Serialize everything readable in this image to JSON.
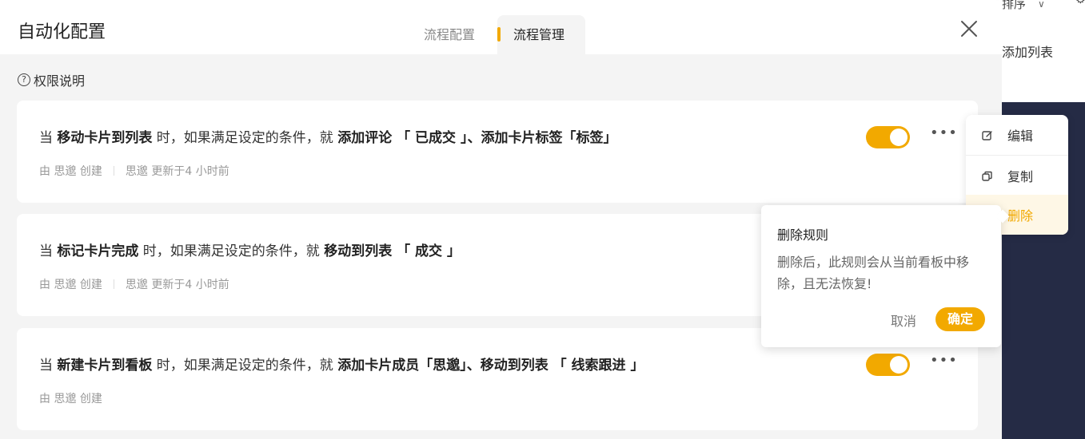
{
  "background": {
    "sort_label": "排序",
    "add_list_label": "添加列表"
  },
  "modal": {
    "title": "自动化配置",
    "tabs": [
      {
        "label": "流程配置"
      },
      {
        "label": "流程管理"
      }
    ],
    "permission_label": "权限说明"
  },
  "rules": [
    {
      "prefix": "当 ",
      "trigger": "移动卡片到列表",
      "middle": " 时，如果满足设定的条件，就 ",
      "action": "添加评论 「 已成交 」、添加卡片标签「标签」",
      "creator": "由 思邈 创建",
      "updated": "思邈 更新于4 小时前",
      "enabled": true
    },
    {
      "prefix": "当 ",
      "trigger": "标记卡片完成",
      "middle": " 时，如果满足设定的条件，就 ",
      "action": "移动到列表 「 成交 」",
      "creator": "由 思邈 创建",
      "updated": "思邈 更新于4 小时前",
      "enabled": true
    },
    {
      "prefix": "当 ",
      "trigger": "新建卡片到看板",
      "middle": " 时，如果满足设定的条件，就 ",
      "action": "添加卡片成员「思邈」、移动到列表 「 线索跟进 」",
      "creator": "由 思邈 创建",
      "enabled": true
    }
  ],
  "context_menu": {
    "edit": "编辑",
    "copy": "复制",
    "delete": "删除"
  },
  "popconfirm": {
    "title": "删除规则",
    "body": "删除后，此规则会从当前看板中移除，且无法恢复!",
    "cancel": "取消",
    "ok": "确定"
  },
  "colors": {
    "accent": "#f2a900",
    "sidebar_dark": "#252b45"
  }
}
